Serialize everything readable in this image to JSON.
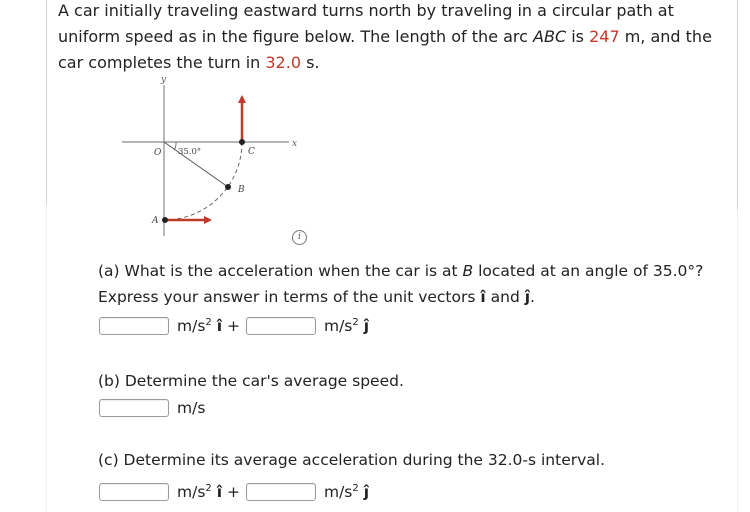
{
  "problem": {
    "intro_1": "A car initially traveling eastward turns north by traveling in a circular path at uniform speed as in the figure below. The length of the arc ",
    "arc_name": "ABC",
    "intro_2": " is ",
    "arc_length": "247",
    "intro_3": " m, and the car completes the turn in ",
    "time": "32.0",
    "intro_4": " s."
  },
  "figure": {
    "x_label": "x",
    "y_label": "y",
    "origin_label": "O",
    "point_a": "A",
    "point_b": "B",
    "point_c": "C",
    "angle_label": "35.0°",
    "vector_color": "#c0392b",
    "info_icon": "i"
  },
  "parts": {
    "a": {
      "text_1": "(a) What is the acceleration when the car is at ",
      "point": "B",
      "text_2": " located at an angle of 35.0°? Express your answer in terms of the unit vectors ",
      "i_hat": "î",
      "and": " and ",
      "j_hat": "ĵ",
      "end": ".",
      "unit": "m/s",
      "exp": "2",
      "plus": "+",
      "x_value": "",
      "y_value": ""
    },
    "b": {
      "text": "(b) Determine the car's average speed.",
      "unit": "m/s",
      "value": ""
    },
    "c": {
      "text": "(c) Determine its average acceleration during the 32.0-s interval.",
      "unit": "m/s",
      "exp": "2",
      "i_hat": "î",
      "j_hat": "ĵ",
      "plus": "+",
      "x_value": "",
      "y_value": ""
    }
  }
}
